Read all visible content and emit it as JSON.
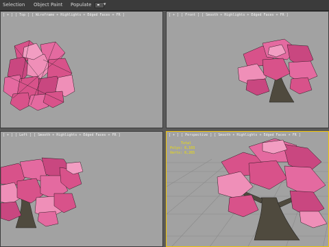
{
  "toolbar": {
    "tabs": [
      {
        "label": "Selection"
      },
      {
        "label": "Object Paint"
      },
      {
        "label": "Populate"
      }
    ],
    "display_icon": "display-options-icon"
  },
  "viewports": {
    "top_left": {
      "label": "[ + ] [ Top ] [ Wireframe + Highlights + Edged Faces + FR ]"
    },
    "top_right": {
      "label": "[ + ] [ Front ] [ Smooth + Highlights + Edged Faces + FR ]"
    },
    "bottom_left": {
      "label": "[ + ] [ Left ] [ Smooth + Highlights + Edged Faces + FR ]"
    },
    "bottom_right": {
      "label": "[ + ] [ Perspective ] [ Smooth + Highlights + Edged Faces + FR ]"
    }
  },
  "stats": {
    "title": "Total",
    "polys_label": "Polys:",
    "polys_value": "6,103",
    "verts_label": "Verts:",
    "verts_value": "6,265"
  },
  "colors": {
    "viewport_bg": "#a2a2a2",
    "active_border": "#f2c400",
    "foliage": "#d8528a",
    "foliage_light": "#ef8fb8",
    "trunk": "#4f4a3e",
    "stats_text": "#f0e000"
  }
}
